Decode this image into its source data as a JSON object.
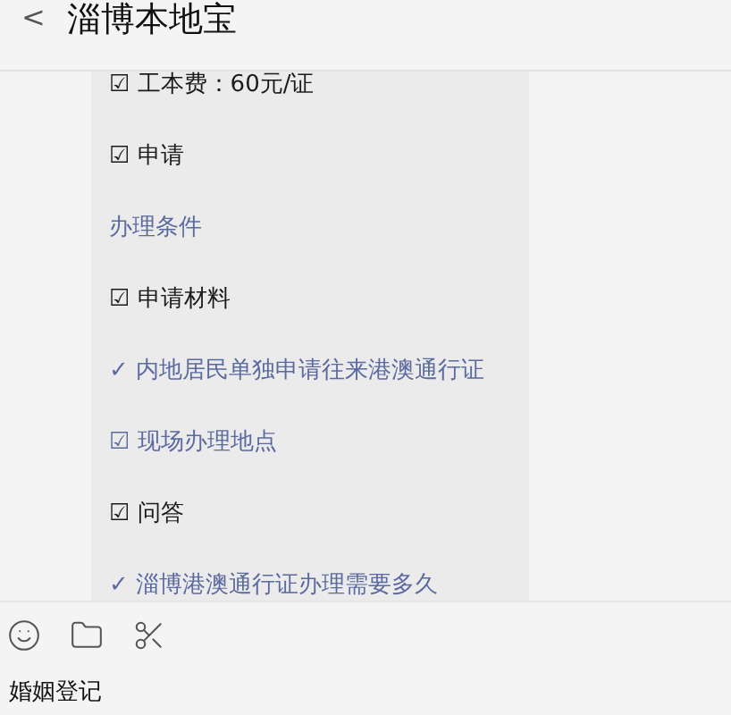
{
  "header": {
    "back": "<",
    "title": "淄博本地宝"
  },
  "message": {
    "items": [
      {
        "marker": "☑",
        "text": "工本费：60元/证",
        "link": false
      },
      {
        "marker": "☑",
        "text": "申请",
        "link": false
      },
      {
        "text": "办理条件",
        "link": true
      },
      {
        "marker": "☑",
        "text": "申请材料",
        "link": false
      },
      {
        "marker": "✓",
        "text": "内地居民单独申请往来港澳通行证",
        "link": true
      },
      {
        "marker": "☑",
        "text": "现场办理地点",
        "link": true
      },
      {
        "marker": "☑",
        "text": "问答",
        "link": false
      },
      {
        "marker": "✓",
        "text": "淄博港澳通行证办理需要多久",
        "link": true
      }
    ]
  },
  "composer": {
    "value": "婚姻登记"
  }
}
